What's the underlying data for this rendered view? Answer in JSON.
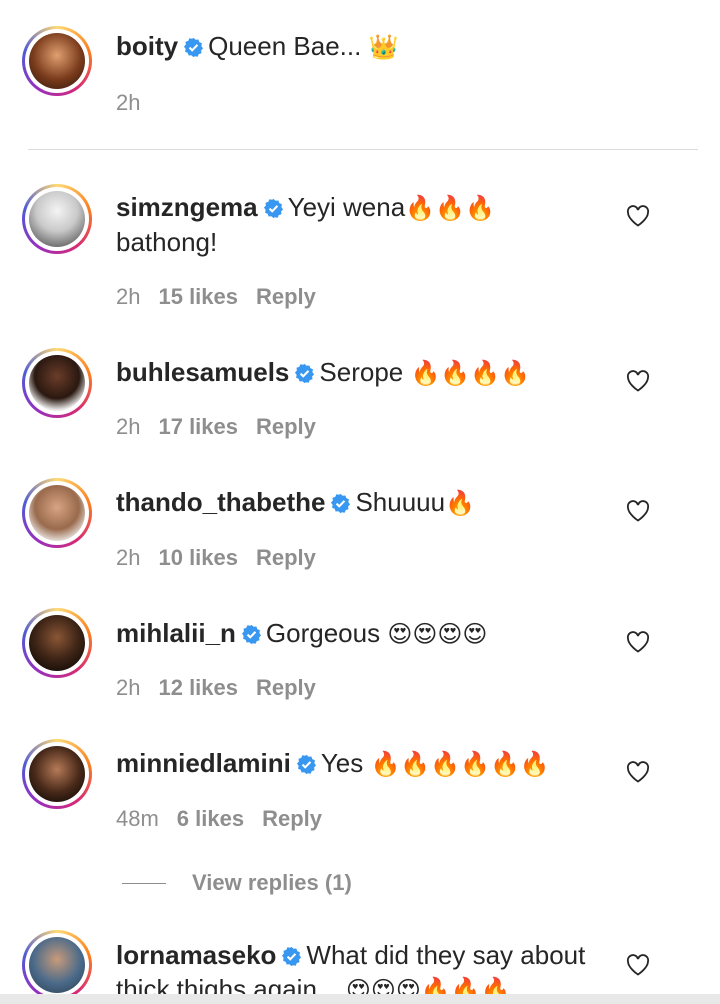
{
  "caption": {
    "username": "boity",
    "text": "Queen Bae... ",
    "emoji": "👑",
    "time": "2h"
  },
  "comments": [
    {
      "username": "simzngema",
      "text": "Yeyi wena",
      "emoji": "🔥🔥🔥",
      "text2": "bathong!",
      "time": "2h",
      "likes": "15 likes",
      "reply": "Reply"
    },
    {
      "username": "buhlesamuels",
      "text": "Serope ",
      "emoji": "🔥🔥🔥🔥",
      "time": "2h",
      "likes": "17 likes",
      "reply": "Reply"
    },
    {
      "username": "thando_thabethe",
      "text": "Shuuuu",
      "emoji": "🔥",
      "time": "2h",
      "likes": "10 likes",
      "reply": "Reply"
    },
    {
      "username": "mihlalii_n",
      "text": "Gorgeous ",
      "emoji": "😍😍😍😍",
      "time": "2h",
      "likes": "12 likes",
      "reply": "Reply"
    },
    {
      "username": "minniedlamini",
      "text": "Yes ",
      "emoji": "🔥🔥🔥🔥🔥🔥",
      "time": "48m",
      "likes": "6 likes",
      "reply": "Reply",
      "view_replies": "View replies (1)"
    },
    {
      "username": "lornamaseko",
      "text": "What did they say about",
      "text2": "thick thighs again....",
      "emoji": "😍😍😍🔥🔥🔥"
    }
  ],
  "colors": {
    "verified": "#3897f0",
    "muted": "#8e8e8e",
    "text": "#262626"
  }
}
